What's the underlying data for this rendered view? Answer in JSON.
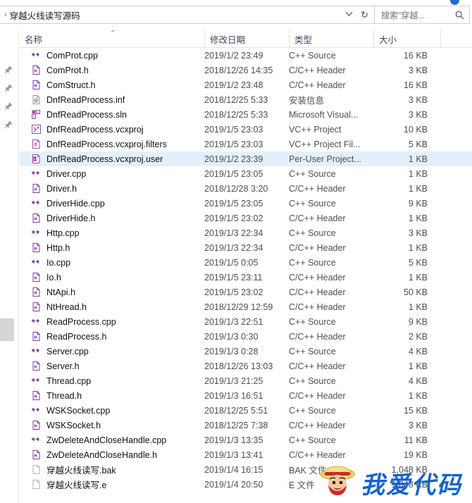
{
  "window": {
    "address_path": "穿越火线读写源码",
    "address_separator": "›",
    "dropdown_icon": "chevron-down-icon",
    "refresh_icon": "refresh-icon",
    "refresh_glyph": "↻"
  },
  "search": {
    "placeholder": "搜索\"穿越...",
    "icon": "search-icon"
  },
  "columns": [
    {
      "key": "name",
      "label": "名称",
      "sorted": "asc",
      "sort_glyph": "⌃"
    },
    {
      "key": "date",
      "label": "修改日期"
    },
    {
      "key": "type",
      "label": "类型"
    },
    {
      "key": "size",
      "label": "大小"
    }
  ],
  "nav_pane": {
    "pin_icon": "pin-icon",
    "pin_count": 4,
    "scrollbar_thumb": "nav-scrollbar-thumb"
  },
  "files": [
    {
      "name": "ComProt.cpp",
      "date": "2019/1/2 23:49",
      "type": "C++ Source",
      "size": "16 KB",
      "icon": "cpp-source-icon",
      "selected": false
    },
    {
      "name": "ComProt.h",
      "date": "2018/12/26 14:35",
      "type": "C/C++ Header",
      "size": "3 KB",
      "icon": "header-file-icon",
      "selected": false
    },
    {
      "name": "ComStruct.h",
      "date": "2019/1/2 23:48",
      "type": "C/C++ Header",
      "size": "16 KB",
      "icon": "header-file-icon",
      "selected": false
    },
    {
      "name": "DnfReadProcess.inf",
      "date": "2018/12/25 5:33",
      "type": "安装信息",
      "size": "3 KB",
      "icon": "inf-setup-icon",
      "selected": false
    },
    {
      "name": "DnfReadProcess.sln",
      "date": "2018/12/25 5:33",
      "type": "Microsoft Visual...",
      "size": "3 KB",
      "icon": "sln-solution-icon",
      "selected": false
    },
    {
      "name": "DnfReadProcess.vcxproj",
      "date": "2019/1/5 23:03",
      "type": "VC++ Project",
      "size": "10 KB",
      "icon": "vcxproj-icon",
      "selected": false
    },
    {
      "name": "DnfReadProcess.vcxproj.filters",
      "date": "2019/1/5 23:03",
      "type": "VC++ Project Fil...",
      "size": "5 KB",
      "icon": "vcxproj-filters-icon",
      "selected": false
    },
    {
      "name": "DnfReadProcess.vcxproj.user",
      "date": "2019/1/2 23:39",
      "type": "Per-User Project...",
      "size": "1 KB",
      "icon": "vcxproj-user-icon",
      "selected": true
    },
    {
      "name": "Driver.cpp",
      "date": "2019/1/5 23:05",
      "type": "C++ Source",
      "size": "1 KB",
      "icon": "cpp-source-icon",
      "selected": false
    },
    {
      "name": "Driver.h",
      "date": "2018/12/28 3:20",
      "type": "C/C++ Header",
      "size": "1 KB",
      "icon": "header-file-icon",
      "selected": false
    },
    {
      "name": "DriverHide.cpp",
      "date": "2019/1/5 23:05",
      "type": "C++ Source",
      "size": "9 KB",
      "icon": "cpp-source-icon",
      "selected": false
    },
    {
      "name": "DriverHide.h",
      "date": "2019/1/5 23:02",
      "type": "C/C++ Header",
      "size": "1 KB",
      "icon": "header-file-icon",
      "selected": false
    },
    {
      "name": "Http.cpp",
      "date": "2019/1/3 22:34",
      "type": "C++ Source",
      "size": "3 KB",
      "icon": "cpp-source-icon",
      "selected": false
    },
    {
      "name": "Http.h",
      "date": "2019/1/3 22:34",
      "type": "C/C++ Header",
      "size": "1 KB",
      "icon": "header-file-icon",
      "selected": false
    },
    {
      "name": "Io.cpp",
      "date": "2019/1/5 0:05",
      "type": "C++ Source",
      "size": "5 KB",
      "icon": "cpp-source-icon",
      "selected": false
    },
    {
      "name": "Io.h",
      "date": "2019/1/5 23:11",
      "type": "C/C++ Header",
      "size": "1 KB",
      "icon": "header-file-icon",
      "selected": false
    },
    {
      "name": "NtApi.h",
      "date": "2019/1/5 23:02",
      "type": "C/C++ Header",
      "size": "50 KB",
      "icon": "header-file-icon",
      "selected": false
    },
    {
      "name": "NtHread.h",
      "date": "2018/12/29 12:59",
      "type": "C/C++ Header",
      "size": "1 KB",
      "icon": "header-file-icon",
      "selected": false
    },
    {
      "name": "ReadProcess.cpp",
      "date": "2019/1/3 22:51",
      "type": "C++ Source",
      "size": "9 KB",
      "icon": "cpp-source-icon",
      "selected": false
    },
    {
      "name": "ReadProcess.h",
      "date": "2019/1/3 0:30",
      "type": "C/C++ Header",
      "size": "2 KB",
      "icon": "header-file-icon",
      "selected": false
    },
    {
      "name": "Server.cpp",
      "date": "2019/1/3 0:28",
      "type": "C++ Source",
      "size": "4 KB",
      "icon": "cpp-source-icon",
      "selected": false
    },
    {
      "name": "Server.h",
      "date": "2018/12/26 13:03",
      "type": "C/C++ Header",
      "size": "1 KB",
      "icon": "header-file-icon",
      "selected": false
    },
    {
      "name": "Thread.cpp",
      "date": "2019/1/3 21:25",
      "type": "C++ Source",
      "size": "4 KB",
      "icon": "cpp-source-icon",
      "selected": false
    },
    {
      "name": "Thread.h",
      "date": "2019/1/3 16:51",
      "type": "C/C++ Header",
      "size": "1 KB",
      "icon": "header-file-icon",
      "selected": false
    },
    {
      "name": "WSKSocket.cpp",
      "date": "2018/12/25 5:51",
      "type": "C++ Source",
      "size": "15 KB",
      "icon": "cpp-source-icon",
      "selected": false
    },
    {
      "name": "WSKSocket.h",
      "date": "2018/12/25 7:38",
      "type": "C/C++ Header",
      "size": "3 KB",
      "icon": "header-file-icon",
      "selected": false
    },
    {
      "name": "ZwDeleteAndCloseHandle.cpp",
      "date": "2019/1/3 13:35",
      "type": "C++ Source",
      "size": "11 KB",
      "icon": "cpp-source-icon",
      "selected": false
    },
    {
      "name": "ZwDeleteAndCloseHandle.h",
      "date": "2019/1/3 13:41",
      "type": "C/C++ Header",
      "size": "19 KB",
      "icon": "header-file-icon",
      "selected": false
    },
    {
      "name": "穿越火线读写.bak",
      "date": "2019/1/4 16:15",
      "type": "BAK 文件",
      "size": "1,048 KB",
      "icon": "blank-file-icon",
      "selected": false
    },
    {
      "name": "穿越火线读写.e",
      "date": "2019/1/4 20:50",
      "type": "E 文件",
      "size": "1,048 KB",
      "icon": "blank-file-icon",
      "selected": false
    }
  ],
  "watermark": {
    "text": "我爱代码",
    "color": "#1464c8",
    "mascot_icon": "luffy-mascot-icon"
  },
  "colors": {
    "selection": "#e3f0fa",
    "header_text": "#3c4a5c",
    "cpp_icon": "#7a3f98",
    "accent": "#1f6fc4"
  }
}
